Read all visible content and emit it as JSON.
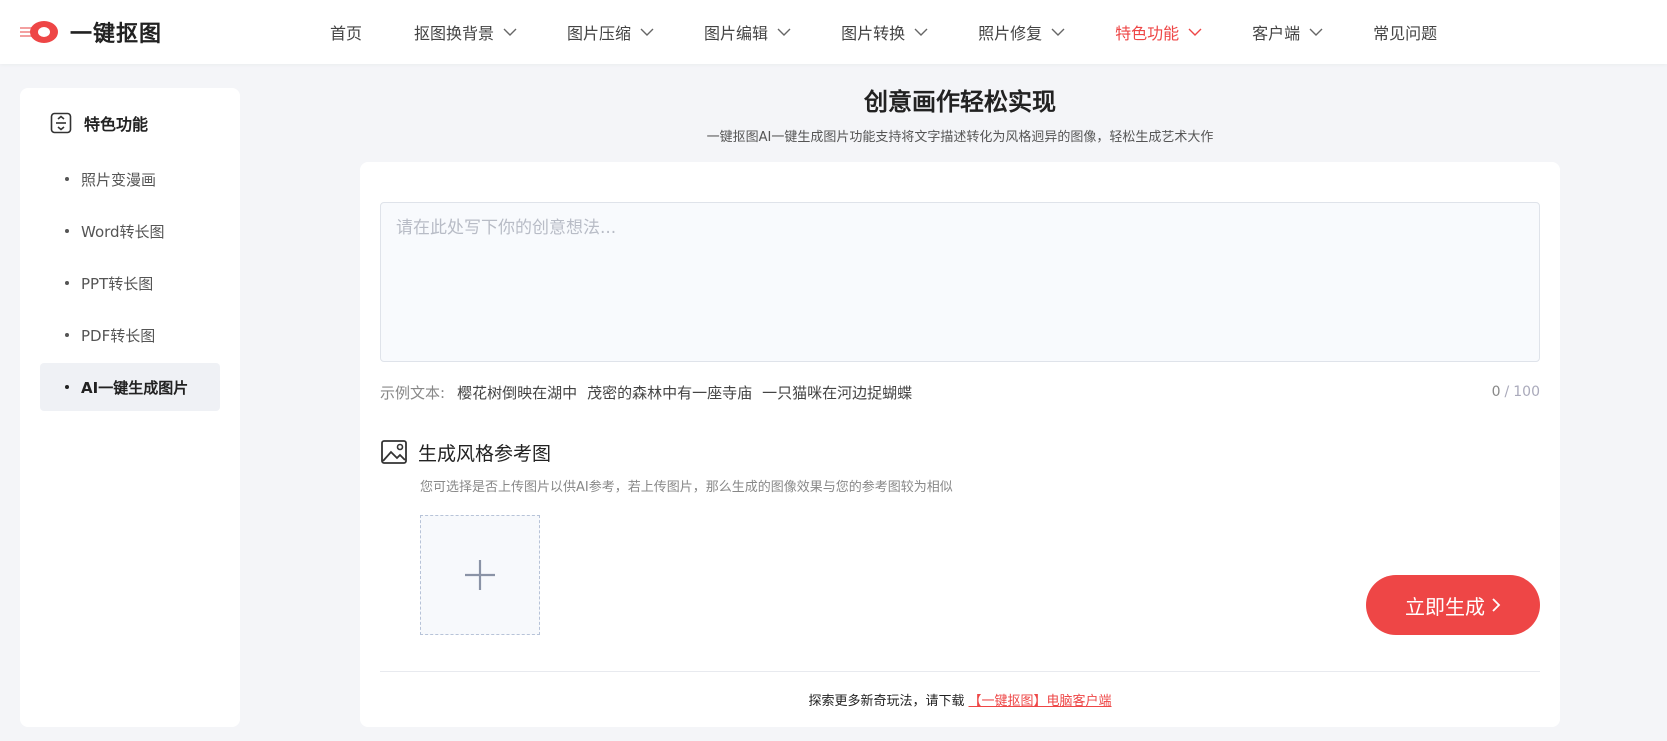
{
  "brand": {
    "name": "一键抠图",
    "accent": "#ee4646"
  },
  "nav": {
    "items": [
      {
        "label": "首页",
        "dropdown": false,
        "active": false
      },
      {
        "label": "抠图换背景",
        "dropdown": true,
        "active": false
      },
      {
        "label": "图片压缩",
        "dropdown": true,
        "active": false
      },
      {
        "label": "图片编辑",
        "dropdown": true,
        "active": false
      },
      {
        "label": "图片转换",
        "dropdown": true,
        "active": false
      },
      {
        "label": "照片修复",
        "dropdown": true,
        "active": false
      },
      {
        "label": "特色功能",
        "dropdown": true,
        "active": true
      },
      {
        "label": "客户端",
        "dropdown": true,
        "active": false
      },
      {
        "label": "常见问题",
        "dropdown": false,
        "active": false
      }
    ]
  },
  "sidebar": {
    "title": "特色功能",
    "items": [
      {
        "label": "照片变漫画",
        "active": false
      },
      {
        "label": "Word转长图",
        "active": false
      },
      {
        "label": "PPT转长图",
        "active": false
      },
      {
        "label": "PDF转长图",
        "active": false
      },
      {
        "label": "AI一键生成图片",
        "active": true
      }
    ]
  },
  "main": {
    "title": "创意画作轻松实现",
    "subtitle": "一键抠图AI一键生成图片功能支持将文字描述转化为风格迥异的图像，轻松生成艺术大作",
    "prompt": {
      "value": "",
      "placeholder": "请在此处写下你的创意想法..."
    },
    "examples": {
      "label": "示例文本:",
      "tags": [
        "樱花树倒映在湖中",
        "茂密的森林中有一座寺庙",
        "一只猫咪在河边捉蝴蝶"
      ]
    },
    "counter": {
      "current": "0",
      "separator": "/",
      "max": "100"
    },
    "reference": {
      "title": "生成风格参考图",
      "desc": "您可选择是否上传图片以供AI参考，若上传图片，那么生成的图像效果与您的参考图较为相似"
    },
    "generate_label": "立即生成",
    "footer": {
      "text": "探索更多新奇玩法，请下载",
      "link": "【一键抠图】电脑客户端"
    }
  }
}
